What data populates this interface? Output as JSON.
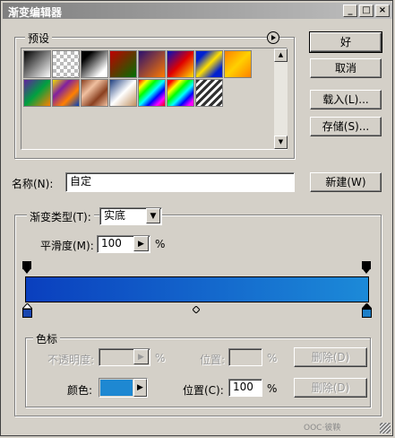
{
  "window": {
    "title": "渐变编辑器",
    "min_label": "_",
    "max_label": "□",
    "close_label": "×"
  },
  "buttons": {
    "ok": "好",
    "cancel": "取消",
    "load": "载入(L)...",
    "save": "存储(S)...",
    "new": "新建(W)",
    "delete": "删除(D)"
  },
  "presets": {
    "label": "预设",
    "menu_icon": "circle-arrow-right-icon",
    "swatches": [
      {
        "name": "black-white-gradient",
        "css": "linear-gradient(135deg,#000,#fff)"
      },
      {
        "name": "transparent-checker-gradient",
        "css": "repeating-conic-gradient(#bbb 0 25%,#fff 0 50%) 0 0/8px 8px"
      },
      {
        "name": "black-to-white-gradient",
        "css": "linear-gradient(135deg,#000 20%,#fff 80%)"
      },
      {
        "name": "red-green-gradient",
        "css": "linear-gradient(135deg,#c00000,#007000)"
      },
      {
        "name": "violet-orange-gradient",
        "css": "linear-gradient(135deg,#2a1070,#ff7a00)"
      },
      {
        "name": "blue-red-yellow-gradient",
        "css": "linear-gradient(135deg,#0010c0,#e00000,#ffe000)"
      },
      {
        "name": "blue-yellow-blue-gradient",
        "css": "linear-gradient(135deg,#0020d0 20%,#ffe000 50%,#0020d0 80%)"
      },
      {
        "name": "orange-yellow-gradient",
        "css": "linear-gradient(135deg,#ff8000,#ffd000,#ff8000)"
      },
      {
        "name": "violet-green-orange-gradient",
        "css": "linear-gradient(135deg,#6020a0,#00a040,#ff8000)"
      },
      {
        "name": "yellow-violet-orange-blue-gradient",
        "css": "linear-gradient(135deg,#f0e000,#8020a0,#ff8000,#0040c0)"
      },
      {
        "name": "copper-gradient",
        "css": "linear-gradient(135deg,#8a4020,#f0c0a0,#8a4020,#f0c0a0)"
      },
      {
        "name": "chrome-gradient",
        "css": "linear-gradient(135deg,#204080,#ffffff 50%,#c09060)"
      },
      {
        "name": "spectrum-gradient",
        "css": "linear-gradient(135deg,#ff0000,#ffff00,#00ff00,#00ffff,#0000ff,#ff00ff,#ff0000)"
      },
      {
        "name": "transparent-rainbow-gradient",
        "css": "linear-gradient(135deg,#ff0000 10%,#ffff00,#00ff00,#00ffff,#0000ff,#ff00ff 90%)"
      },
      {
        "name": "transparent-stripes-gradient",
        "css": "repeating-linear-gradient(135deg,#303030 0 3px,#ffffff 3px 6px)"
      }
    ]
  },
  "name_field": {
    "label": "名称(N):",
    "value": "自定"
  },
  "gradient_type": {
    "label": "渐变类型(T):",
    "value": "实底"
  },
  "smoothness": {
    "label": "平滑度(M):",
    "value": "100",
    "unit": "%"
  },
  "gradient": {
    "start_color": "#0a3fbe",
    "end_color": "#1c8ad8",
    "stop_color_left": "#1846b0",
    "stop_color_right": "#1c7fc8"
  },
  "stops": {
    "label": "色标",
    "opacity_label": "不透明度:",
    "opacity_unit": "%",
    "location_label_disabled": "位置:",
    "location_unit_disabled": "%",
    "color_label": "颜色:",
    "color_value": "#1e88d2",
    "location_label": "位置(C):",
    "location_value": "100",
    "location_unit": "%"
  },
  "watermark": "OOC·彼鞅"
}
